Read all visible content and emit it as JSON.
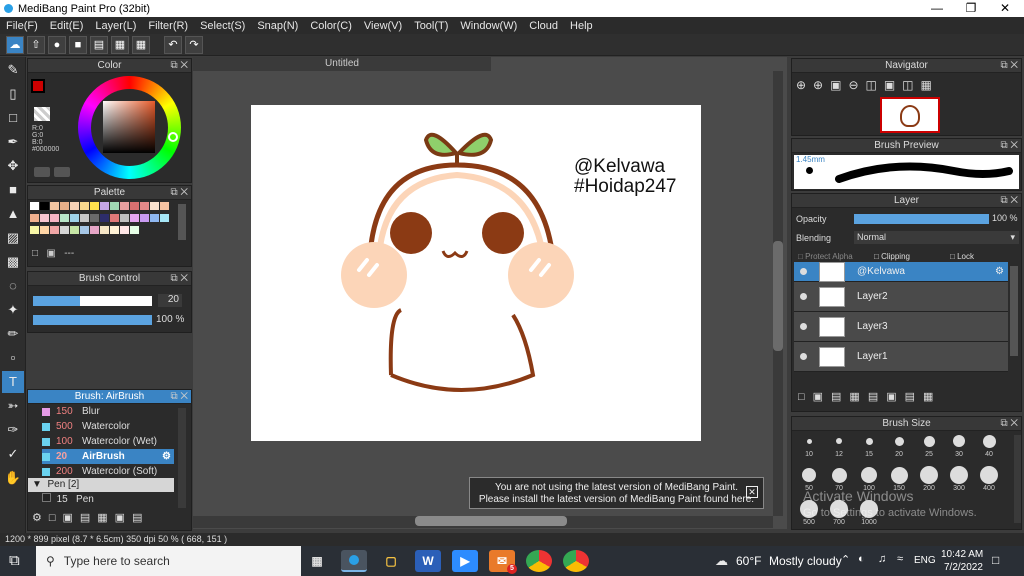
{
  "window": {
    "title": "MediBang Paint Pro (32bit)"
  },
  "menu": [
    "File(F)",
    "Edit(E)",
    "Layer(L)",
    "Filter(R)",
    "Select(S)",
    "Snap(N)",
    "Color(C)",
    "View(V)",
    "Tool(T)",
    "Window(W)",
    "Cloud",
    "Help"
  ],
  "color_panel": {
    "title": "Color",
    "r": "R:0",
    "g": "G:0",
    "b": "B:0",
    "hex": "#000000"
  },
  "palette": {
    "title": "Palette",
    "dash": "---"
  },
  "brush_control": {
    "title": "Brush Control",
    "size": "20",
    "opacity": "100 %",
    "size_fill": 0.5,
    "opacity_fill": 1.0
  },
  "brush_list": {
    "title": "Brush: AirBrush",
    "items": [
      {
        "size": "150",
        "name": "Blur",
        "color": "#e59ae6"
      },
      {
        "size": "500",
        "name": "Watercolor",
        "color": "#6ad2ef"
      },
      {
        "size": "100",
        "name": "Watercolor (Wet)",
        "color": "#6ad2ef"
      },
      {
        "size": "20",
        "name": "AirBrush",
        "color": "#6ad2ef"
      },
      {
        "size": "200",
        "name": "Watercolor (Soft)",
        "color": "#6ad2ef"
      }
    ],
    "group": "Pen [2]",
    "pen": {
      "size": "15",
      "name": "Pen"
    }
  },
  "document": {
    "tab": "Untitled",
    "text1": "@Kelvawa",
    "text2": "#Hoidap247"
  },
  "notification": {
    "line1": "You are not using the latest version of MediBang Paint.",
    "line2": "Please install the latest version of MediBang Paint found here."
  },
  "navigator": {
    "title": "Navigator"
  },
  "brush_preview": {
    "title": "Brush Preview",
    "size": "1.45mm"
  },
  "layer_panel": {
    "title": "Layer",
    "opacity_label": "Opacity",
    "opacity_value": "100 %",
    "blending_label": "Blending",
    "blending_value": "Normal",
    "protect_alpha": "Protect Alpha",
    "clipping": "Clipping",
    "lock": "Lock",
    "layers": [
      "@Kelvawa",
      "Layer2",
      "Layer3",
      "Layer1"
    ]
  },
  "brush_size": {
    "title": "Brush Size",
    "row1": [
      "10",
      "12",
      "15",
      "20",
      "25",
      "30",
      "40"
    ],
    "row2": [
      "50",
      "70",
      "100",
      "150",
      "200",
      "300",
      "400"
    ],
    "row3": [
      "500",
      "700",
      "1000"
    ]
  },
  "watermark": {
    "line1": "Activate Windows",
    "line2": "Go to Settings to activate Windows."
  },
  "status": "1200 * 899 pixel  (8.7 * 6.5cm)  350 dpi  50 %  ( 668, 151 )",
  "taskbar": {
    "search_placeholder": "Type here to search",
    "weather_temp": "60°F",
    "weather_desc": "Mostly cloudy",
    "lang": "ENG",
    "time": "10:42 AM",
    "date": "7/2/2022",
    "mail_badge": "5"
  },
  "colors": {
    "accent": "#3a84c4",
    "sprout": "#8fcf6b",
    "outline": "#8b3a14",
    "cheek": "#fcd5b8"
  }
}
